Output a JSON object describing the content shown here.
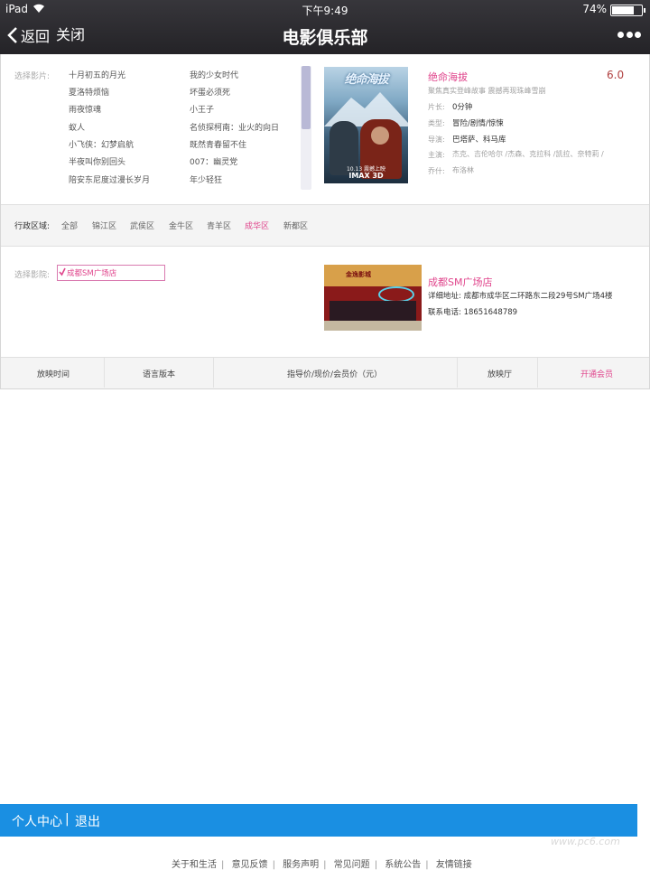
{
  "status_bar": {
    "device": "iPad",
    "time": "下午9:49",
    "battery": "74%"
  },
  "nav": {
    "back_label": "返回",
    "close_label": "关闭",
    "title": "电影俱乐部"
  },
  "movie_section": {
    "label": "选择影片:",
    "movies_col1": [
      "十月初五的月光",
      "夏洛特烦恼",
      "雨夜惊魂",
      "蚁人",
      "小飞侠：幻梦启航",
      "半夜叫你别回头",
      "陪安东尼度过漫长岁月"
    ],
    "movies_col2": [
      "我的少女时代",
      "坏蛋必须死",
      "小王子",
      "名侦探柯南：业火的向日",
      "既然青春留不住",
      "007：幽灵党",
      "年少轻狂"
    ],
    "poster": {
      "title": "绝命海拔",
      "date": "10.13 震撼上映",
      "format": "IMAX 3D"
    },
    "selected": {
      "name": "绝命海拔",
      "rating": "6.0",
      "tagline": "聚焦真实登峰故事 震撼再现珠峰雪崩",
      "details": [
        {
          "label": "片长:",
          "value": "0分钟"
        },
        {
          "label": "类型:",
          "value": "冒险/剧情/惊悚"
        },
        {
          "label": "导演:",
          "value": "巴塔萨、科马库"
        },
        {
          "label": "主演:",
          "value": "杰克、吉伦哈尔 /杰森、克拉科 /凯拉、奈特莉 /"
        },
        {
          "label": "乔什:",
          "value": "布洛林"
        }
      ]
    }
  },
  "district_filter": {
    "label": "行政区域:",
    "items": [
      "全部",
      "锦江区",
      "武侯区",
      "金牛区",
      "青羊区",
      "成华区",
      "新都区"
    ],
    "active": "成华区"
  },
  "cinema_section": {
    "label": "选择影院:",
    "selected_option": "成都SM广场店",
    "photo_sign": "金逸影城",
    "name": "成都SM广场店",
    "address": "详细地址:  成都市成华区二环路东二段29号SM广场4楼",
    "phone": "联系电话:  18651648789"
  },
  "table_header": [
    "放映时间",
    "语言版本",
    "指导价/现价/会员价（元）",
    "放映厅",
    "开通会员"
  ],
  "bottom_bar": {
    "personal_center": "个人中心",
    "separator": "|",
    "logout": "退出"
  },
  "footer_links": [
    "关于和生活",
    "意见反馈",
    "服务声明",
    "常见问题",
    "系统公告",
    "友情链接"
  ],
  "watermark": "www.pc6.com",
  "colors": {
    "accent_pink": "#e0458c",
    "rating_red": "#b04040",
    "bottom_bar_blue": "#1a8fe2",
    "nav_dark": "#2e2d32"
  }
}
